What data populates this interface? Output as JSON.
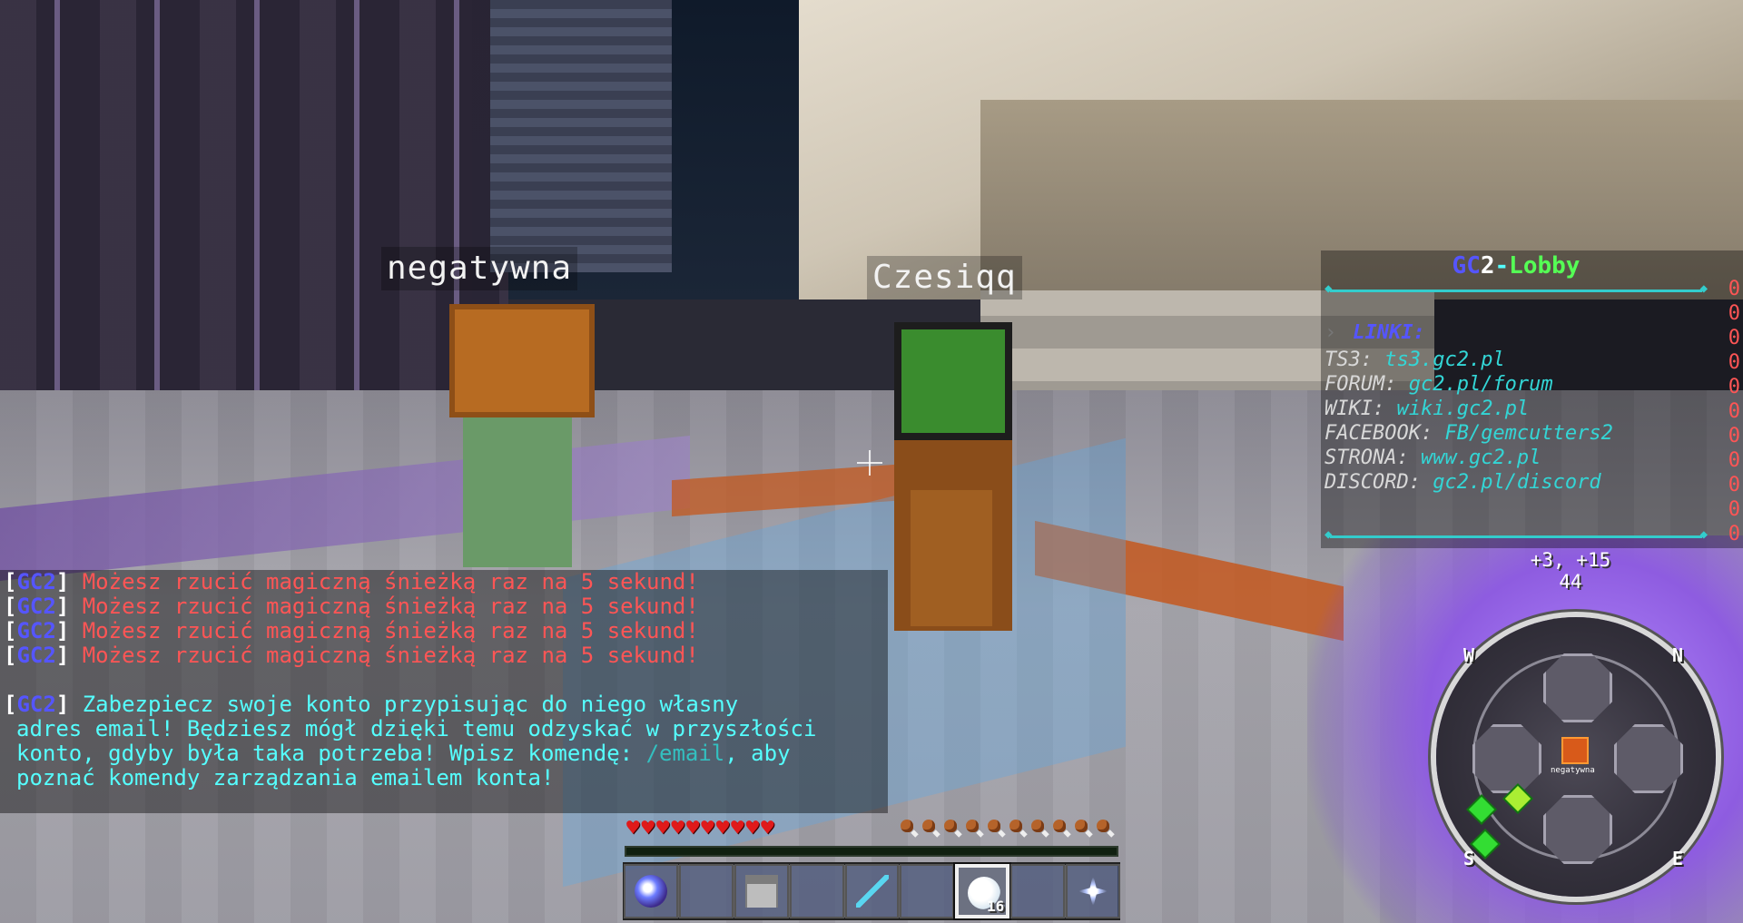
{
  "world": {
    "nametags": [
      "negatywna",
      "Czesiqq"
    ]
  },
  "scoreboard": {
    "title_parts": [
      "GC",
      "2",
      "-",
      "Lobby"
    ],
    "header": "LINKI:",
    "rows": [
      {
        "label": "TS3: ",
        "value": "ts3.gc2.pl"
      },
      {
        "label": "FORUM: ",
        "value": "gc2.pl/forum"
      },
      {
        "label": "WIKI: ",
        "value": "wiki.gc2.pl"
      },
      {
        "label": "FACEBOOK: ",
        "value": "FB/gemcutters2"
      },
      {
        "label": "STRONA: ",
        "value": "www.gc2.pl"
      },
      {
        "label": "DISCORD: ",
        "value": "gc2.pl/discord"
      }
    ],
    "scores": [
      "0",
      "0",
      "0",
      "0",
      "0",
      "0",
      "0",
      "0",
      "0",
      "0",
      "0"
    ]
  },
  "chat": {
    "prefix_open": "[",
    "prefix_tag": "GC2",
    "prefix_close": "]",
    "cooldown_message": "Możesz rzucić magiczną śnieżką raz na 5 sekund!",
    "email_line1": "Zabezpiecz swoje konto przypisując do niego własny",
    "email_line2": "adres email! Będziesz mógł dzięki temu odzyskać w przyszłości",
    "email_line3a": "konto, gdyby była taka potrzeba! Wpisz komendę: ",
    "email_command": "/email",
    "email_line3b": ", aby",
    "email_line4": "poznać komendy zarządzania emailem konta!"
  },
  "coords": {
    "xz": "+3, +15",
    "y": "44"
  },
  "minimap": {
    "compass": {
      "w": "W",
      "n": "N",
      "s": "S",
      "e": "E"
    },
    "player_label": "negatywna"
  },
  "hud": {
    "health_hearts": 10,
    "hunger_drumsticks": 10,
    "xp_progress": 0,
    "selected_slot": 7,
    "hotbar": [
      {
        "icon": "ender-orb-icon",
        "count": ""
      },
      {
        "icon": "empty-slot",
        "count": ""
      },
      {
        "icon": "skeleton-skull-icon",
        "count": ""
      },
      {
        "icon": "empty-slot",
        "count": ""
      },
      {
        "icon": "diamond-sword-icon",
        "count": ""
      },
      {
        "icon": "empty-slot",
        "count": ""
      },
      {
        "icon": "snowball-icon",
        "count": "16"
      },
      {
        "icon": "empty-slot",
        "count": ""
      },
      {
        "icon": "nether-star-icon",
        "count": ""
      }
    ]
  },
  "colors": {
    "tag_blue": "#5555ff",
    "chat_red": "#ff5555",
    "chat_cyan": "#55ffff",
    "lobby_green": "#55ff55",
    "score_red": "#ff5555"
  }
}
